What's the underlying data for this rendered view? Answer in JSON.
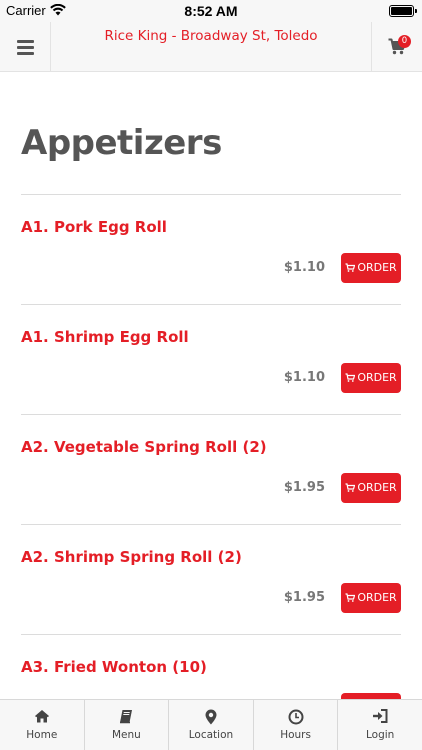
{
  "status_bar": {
    "carrier": "Carrier",
    "time": "8:52 AM"
  },
  "header": {
    "title": "Rice King - Broadway St, Toledo",
    "cart_count": "0"
  },
  "section": {
    "title": "Appetizers"
  },
  "order_label": "ORDER",
  "items": [
    {
      "name": "A1. Pork Egg Roll",
      "price": "$1.10"
    },
    {
      "name": "A1. Shrimp Egg Roll",
      "price": "$1.10"
    },
    {
      "name": "A2. Vegetable Spring Roll (2)",
      "price": "$1.95"
    },
    {
      "name": "A2. Shrimp Spring Roll (2)",
      "price": "$1.95"
    },
    {
      "name": "A3. Fried Wonton (10)",
      "price": ""
    }
  ],
  "tabs": [
    {
      "label": "Home",
      "icon": "home-icon"
    },
    {
      "label": "Menu",
      "icon": "book-icon"
    },
    {
      "label": "Location",
      "icon": "map-pin-icon"
    },
    {
      "label": "Hours",
      "icon": "clock-icon"
    },
    {
      "label": "Login",
      "icon": "sign-in-icon"
    }
  ],
  "colors": {
    "accent": "#e41e26",
    "title_gray": "#555555",
    "price_gray": "#777777"
  }
}
